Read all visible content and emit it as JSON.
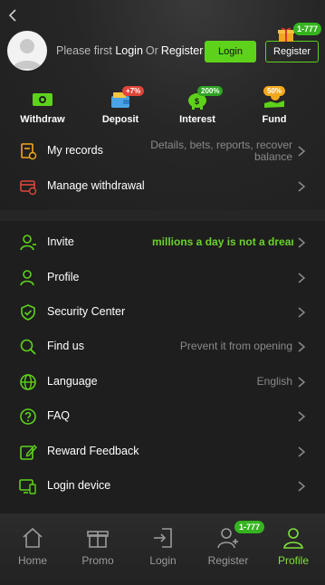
{
  "header": {
    "prompt_prefix": "Please first",
    "prompt_login": "Login",
    "prompt_or": "Or",
    "prompt_register": "Register",
    "login_button": "Login",
    "register_button": "Register",
    "register_bonus": "1-777"
  },
  "quick_actions": [
    {
      "label": "Withdraw",
      "badge": ""
    },
    {
      "label": "Deposit",
      "badge": "+7%"
    },
    {
      "label": "Interest",
      "badge": "200%"
    },
    {
      "label": "Fund",
      "badge": "50%"
    }
  ],
  "menu_top": [
    {
      "label": "My records",
      "value": "Details, bets, reports, recover balance"
    },
    {
      "label": "Manage withdrawal",
      "value": ""
    }
  ],
  "menu_main": [
    {
      "label": "Invite",
      "value": "Earn millions a day is not a dream"
    },
    {
      "label": "Profile",
      "value": ""
    },
    {
      "label": "Security Center",
      "value": ""
    },
    {
      "label": "Find us",
      "value": "Prevent it from opening"
    },
    {
      "label": "Language",
      "value": "English"
    },
    {
      "label": "FAQ",
      "value": ""
    },
    {
      "label": "Reward Feedback",
      "value": ""
    },
    {
      "label": "Login device",
      "value": ""
    }
  ],
  "bottom_nav": [
    {
      "label": "Home"
    },
    {
      "label": "Promo"
    },
    {
      "label": "Login"
    },
    {
      "label": "Register"
    },
    {
      "label": "Profile"
    }
  ],
  "nav_badge": "1-777",
  "colors": {
    "accent": "#5ed21b",
    "background": "#1e1e1e",
    "muted": "#8a8a8a"
  }
}
